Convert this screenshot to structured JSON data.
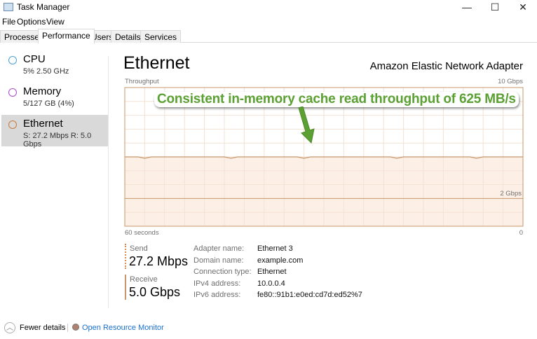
{
  "window": {
    "title": "Task Manager",
    "minimize": "—",
    "maximize": "☐",
    "close": "✕"
  },
  "menu": [
    "File",
    "Options",
    "View"
  ],
  "tabs": [
    "Processes",
    "Performance",
    "Users",
    "Details",
    "Services"
  ],
  "sidebar": [
    {
      "name": "CPU",
      "sub": "5% 2.50 GHz",
      "color": "#4a9fd8"
    },
    {
      "name": "Memory",
      "sub": "5/127 GB (4%)",
      "color": "#a84bc8"
    },
    {
      "name": "Ethernet",
      "sub": "S: 27.2 Mbps R: 5.0 Gbps",
      "color": "#c87a3c"
    }
  ],
  "main": {
    "title": "Ethernet",
    "adapter": "Amazon Elastic Network Adapter"
  },
  "graph": {
    "label": "Throughput",
    "max_label": "10 Gbps",
    "mid_label": "2 Gbps",
    "x_left": "60 seconds",
    "x_right": "0",
    "receive_gbps": 5.0,
    "max_gbps": 10,
    "scale_line_gbps": 2,
    "line_color": "#c9976b",
    "fill_color": "#fcefe5"
  },
  "annotation": "Consistent in-memory cache read throughput of 625 MB/s",
  "stats": {
    "send_label": "Send",
    "send_value": "27.2 Mbps",
    "receive_label": "Receive",
    "receive_value": "5.0 Gbps"
  },
  "details": [
    {
      "k": "Adapter name:",
      "v": "Ethernet 3"
    },
    {
      "k": "Domain name:",
      "v": "example.com"
    },
    {
      "k": "Connection type:",
      "v": "Ethernet"
    },
    {
      "k": "IPv4 address:",
      "v": "10.0.0.4"
    },
    {
      "k": "IPv6 address:",
      "v": "fe80::91b1:e0ed:cd7d:ed52%7"
    }
  ],
  "footer": {
    "fewer": "Fewer details",
    "monitor": "Open Resource Monitor"
  }
}
